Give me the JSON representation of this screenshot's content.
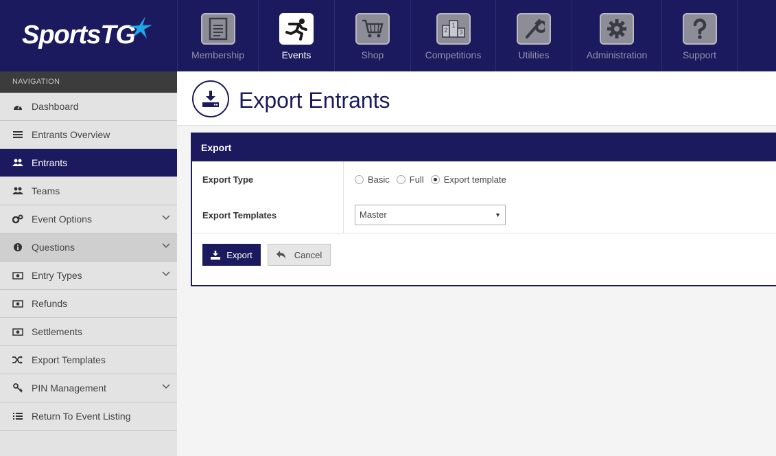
{
  "brand": {
    "name": "SportsTG",
    "star_color": "#1ea7e8"
  },
  "colors": {
    "primary": "#1c1a5e",
    "sidebar_bg": "#e3e3e3",
    "nav_heading_bg": "#3c3c3c"
  },
  "topnav": [
    {
      "label": "Membership",
      "icon": "clipboard-icon"
    },
    {
      "label": "Events",
      "icon": "running-person-icon",
      "active": true
    },
    {
      "label": "Shop",
      "icon": "shopping-cart-icon"
    },
    {
      "label": "Competitions",
      "icon": "podium-icon"
    },
    {
      "label": "Utilities",
      "icon": "wrench-icon"
    },
    {
      "label": "Administration",
      "icon": "gear-icon"
    },
    {
      "label": "Support",
      "icon": "question-icon"
    }
  ],
  "sidebar": {
    "heading": "NAVIGATION",
    "items": [
      {
        "label": "Dashboard",
        "icon": "dashboard-icon"
      },
      {
        "label": "Entrants Overview",
        "icon": "list-icon"
      },
      {
        "label": "Entrants",
        "icon": "users-icon",
        "active": true
      },
      {
        "label": "Teams",
        "icon": "users-icon"
      },
      {
        "label": "Event Options",
        "icon": "cogs-icon",
        "expandable": true
      },
      {
        "label": "Questions",
        "icon": "info-icon",
        "expandable": true
      },
      {
        "label": "Entry Types",
        "icon": "money-icon",
        "expandable": true
      },
      {
        "label": "Refunds",
        "icon": "money-icon"
      },
      {
        "label": "Settlements",
        "icon": "money-icon"
      },
      {
        "label": "Export Templates",
        "icon": "shuffle-icon"
      },
      {
        "label": "PIN Management",
        "icon": "key-icon",
        "expandable": true
      },
      {
        "label": "Return To Event Listing",
        "icon": "list-icon"
      }
    ]
  },
  "page": {
    "title": "Export Entrants",
    "icon": "download-icon"
  },
  "panel": {
    "title": "Export",
    "export_type_label": "Export Type",
    "export_type_options": [
      {
        "label": "Basic",
        "checked": false
      },
      {
        "label": "Full",
        "checked": false
      },
      {
        "label": "Export template",
        "checked": true
      }
    ],
    "templates_label": "Export Templates",
    "templates_selected": "Master",
    "export_button": "Export",
    "cancel_button": "Cancel"
  }
}
